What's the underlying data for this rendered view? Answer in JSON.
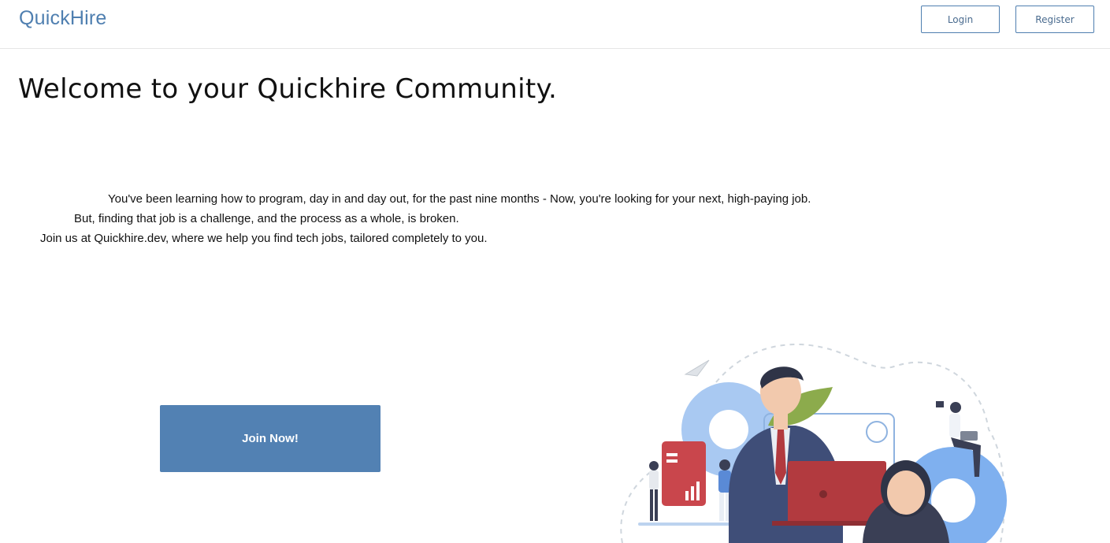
{
  "header": {
    "brand": "QuickHire",
    "login_label": "Login",
    "register_label": "Register"
  },
  "hero": {
    "headline": "Welcome to your Quickhire Community.",
    "lines": [
      "You've been learning how to program, day in and day out, for the past nine months - Now, you're looking for your next, high-paying job.",
      "But, finding that job is a challenge, and the process as a whole, is broken.",
      "Join us at Quickhire.dev, where we help you find tech jobs, tailored completely to you."
    ],
    "cta_label": "Join Now!"
  },
  "colors": {
    "brand": "#4f7fb0",
    "cta": "#5281b3"
  }
}
